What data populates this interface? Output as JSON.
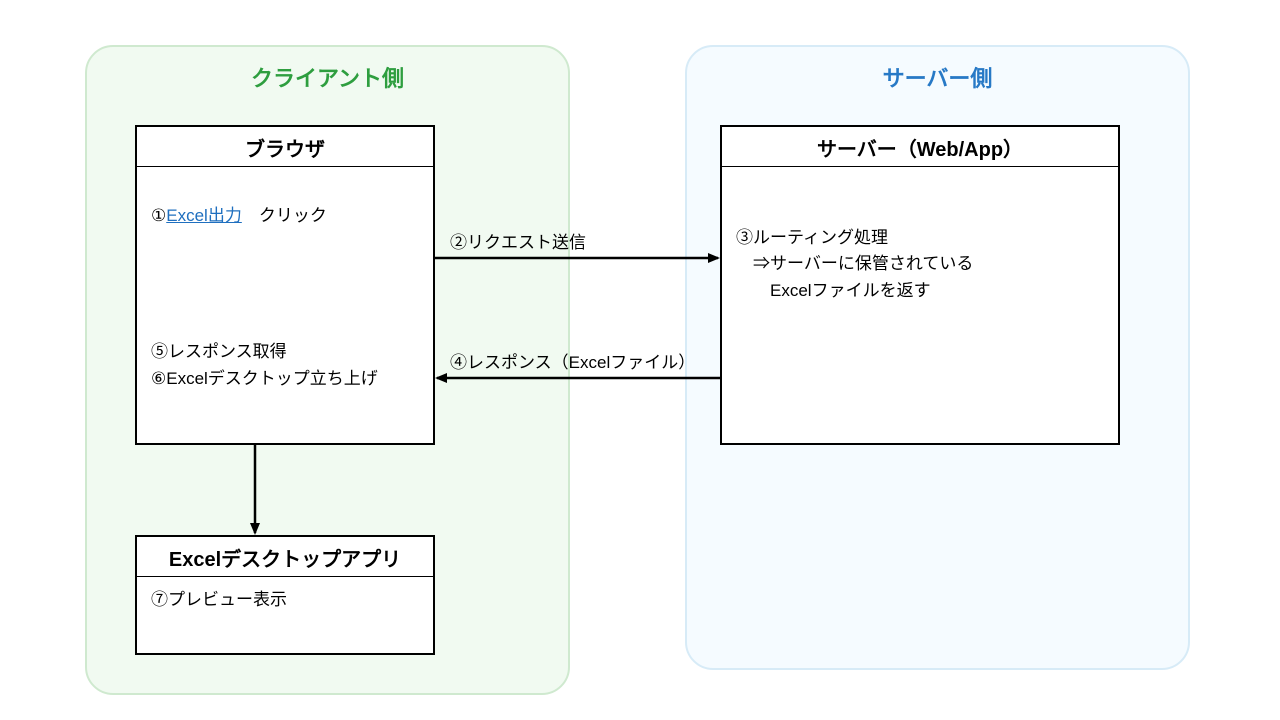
{
  "zones": {
    "client": {
      "label": "クライアント側",
      "color": "#2e9e3f",
      "fill": "#f1faf1",
      "border": "#cfe9cf"
    },
    "server": {
      "label": "サーバー側",
      "color": "#2779c6",
      "fill": "#f5fbff",
      "border": "#d7ebf7"
    }
  },
  "boxes": {
    "browser": {
      "title": "ブラウザ",
      "step1_prefix": "①",
      "step1_link": "Excel出力",
      "step1_suffix": "　クリック",
      "step5": "⑤レスポンス取得",
      "step6": "⑥Excelデスクトップ立ち上げ"
    },
    "webapp": {
      "title": "サーバー（Web/App）",
      "step3a": "③ルーティング処理",
      "step3b": "　⇒サーバーに保管されている",
      "step3c": "　　Excelファイルを返す"
    },
    "excelapp": {
      "title": "Excelデスクトップアプリ",
      "step7": "⑦プレビュー表示"
    }
  },
  "arrows": {
    "request": "②リクエスト送信",
    "response": "④レスポンス（Excelファイル）"
  }
}
